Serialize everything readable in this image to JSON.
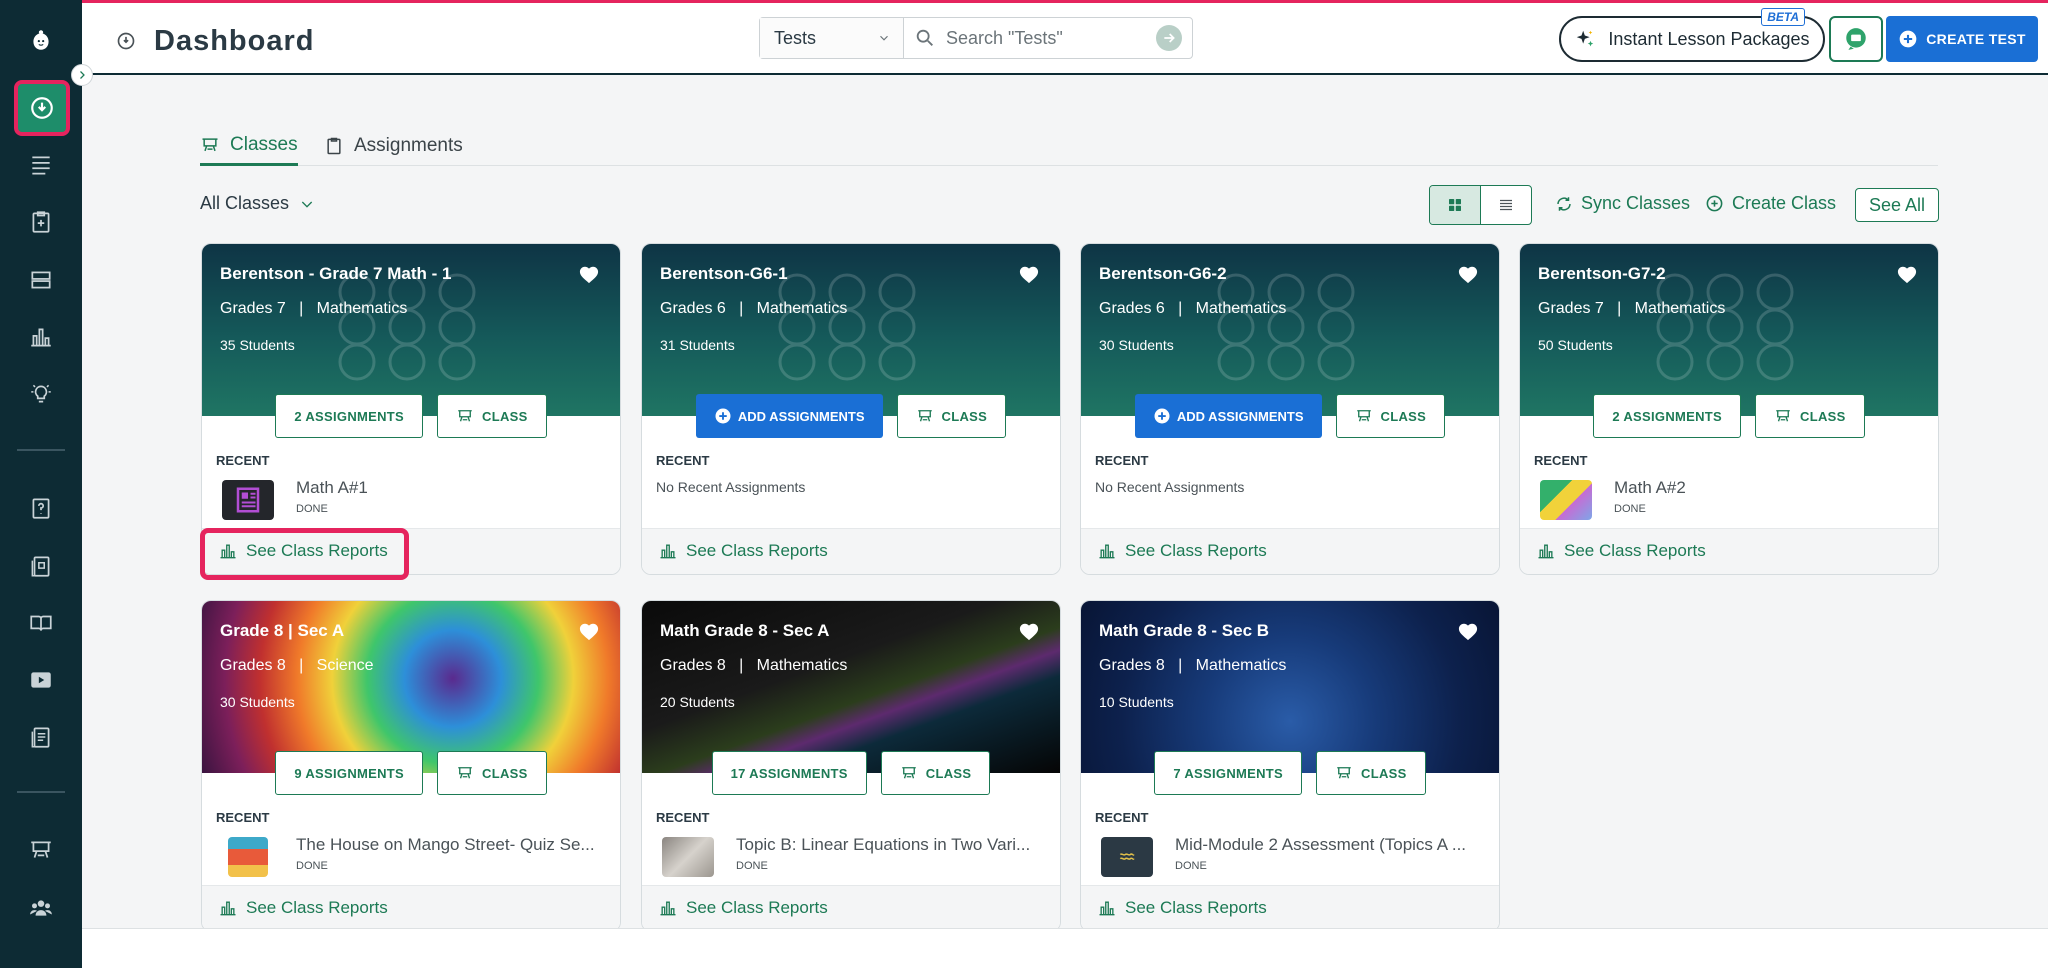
{
  "header": {
    "title": "Dashboard",
    "search_scope": "Tests",
    "search_placeholder": "Search \"Tests\"",
    "instant_lesson_label": "Instant Lesson Packages",
    "beta_badge": "BETA",
    "create_test_label": "CREATE TEST"
  },
  "tabs": [
    {
      "label": "Classes",
      "active": true
    },
    {
      "label": "Assignments",
      "active": false
    }
  ],
  "toolbar": {
    "filter_label": "All Classes",
    "sync_label": "Sync Classes",
    "create_class_label": "Create Class",
    "see_all_label": "See All"
  },
  "colors": {
    "brand_green": "#1d7a55",
    "primary_blue": "#1a6fd5",
    "sidebar_bg": "#0d2b34",
    "highlight": "#e5245e"
  },
  "cards": [
    {
      "title": "Berentson - Grade 7 Math - 1",
      "grade": "Grades 7",
      "subject": "Mathematics",
      "students": "35 Students",
      "assign_label": "2 ASSIGNMENTS",
      "class_label": "CLASS",
      "recent_label": "RECENT",
      "recent_name": "Math A#1",
      "recent_status": "DONE",
      "reports_label": "See Class Reports"
    },
    {
      "title": "Berentson-G6-1",
      "grade": "Grades 6",
      "subject": "Mathematics",
      "students": "31 Students",
      "assign_label": "ADD ASSIGNMENTS",
      "class_label": "CLASS",
      "recent_label": "RECENT",
      "recent_empty": "No Recent Assignments",
      "reports_label": "See Class Reports"
    },
    {
      "title": "Berentson-G6-2",
      "grade": "Grades 6",
      "subject": "Mathematics",
      "students": "30 Students",
      "assign_label": "ADD ASSIGNMENTS",
      "class_label": "CLASS",
      "recent_label": "RECENT",
      "recent_empty": "No Recent Assignments",
      "reports_label": "See Class Reports"
    },
    {
      "title": "Berentson-G7-2",
      "grade": "Grades 7",
      "subject": "Mathematics",
      "students": "50 Students",
      "assign_label": "2 ASSIGNMENTS",
      "class_label": "CLASS",
      "recent_label": "RECENT",
      "recent_name": "Math A#2",
      "recent_status": "DONE",
      "reports_label": "See Class Reports"
    },
    {
      "title": "Grade 8 | Sec A",
      "grade": "Grades 8",
      "subject": "Science",
      "students": "30 Students",
      "assign_label": "9 ASSIGNMENTS",
      "class_label": "CLASS",
      "recent_label": "RECENT",
      "recent_name": "The House on Mango Street- Quiz Se...",
      "recent_status": "DONE",
      "reports_label": "See Class Reports"
    },
    {
      "title": "Math Grade 8 - Sec A",
      "grade": "Grades 8",
      "subject": "Mathematics",
      "students": "20 Students",
      "assign_label": "17 ASSIGNMENTS",
      "class_label": "CLASS",
      "recent_label": "RECENT",
      "recent_name": "Topic B: Linear Equations in Two Vari...",
      "recent_status": "DONE",
      "reports_label": "See Class Reports"
    },
    {
      "title": "Math Grade 8 - Sec B",
      "grade": "Grades 8",
      "subject": "Mathematics",
      "students": "10 Students",
      "assign_label": "7 ASSIGNMENTS",
      "class_label": "CLASS",
      "recent_label": "RECENT",
      "recent_name": "Mid-Module 2 Assessment (Topics A ...",
      "recent_status": "DONE",
      "reports_label": "See Class Reports"
    }
  ],
  "separator": "|"
}
